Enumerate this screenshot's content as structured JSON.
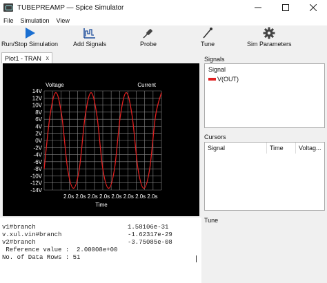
{
  "window": {
    "title": "TUBEPREAMP — Spice Simulator",
    "minimize_icon": "minimize-icon",
    "maximize_icon": "maximize-icon",
    "close_icon": "close-icon"
  },
  "menu": [
    "File",
    "Simulation",
    "View"
  ],
  "toolbar": [
    {
      "label": "Run/Stop Simulation",
      "icon": "play-icon"
    },
    {
      "label": "Add Signals",
      "icon": "signal-icon"
    },
    {
      "label": "Probe",
      "icon": "probe-icon"
    },
    {
      "label": "Tune",
      "icon": "tune-icon"
    },
    {
      "label": "Sim Parameters",
      "icon": "gear-icon"
    }
  ],
  "tab": {
    "label": "Plot1 - TRAN",
    "close": "x"
  },
  "plot": {
    "left_axis_label": "Voltage",
    "right_axis_label": "Current",
    "xlabel": "Time",
    "background": "#000000",
    "grid_color": "#8a8a8a",
    "trace_color": "#e02020",
    "y_ticks": [
      "14V",
      "12V",
      "10V",
      "8V",
      "6V",
      "4V",
      "2V",
      "0V",
      "-2V",
      "-4V",
      "-6V",
      "-8V",
      "-10V",
      "-12V",
      "-14V"
    ],
    "x_ticks": "2.0s 2.0s 2.0s 2.0s 2.0s 2.0s 2.0s 2.0s",
    "trace_name": "V(OUT)"
  },
  "chart_data": {
    "type": "line",
    "title": "",
    "xlabel": "Time",
    "ylabel": "Voltage",
    "ylim": [
      -14,
      14
    ],
    "grid": true,
    "series": [
      {
        "name": "V(OUT)",
        "color": "#e02020",
        "x": [
          0,
          0.5,
          1,
          1.5,
          2,
          2.5,
          3,
          3.5,
          4,
          4.5,
          5,
          5.5,
          6,
          6.5,
          7,
          7.5,
          8,
          8.5,
          9,
          9.5,
          10
        ],
        "values": [
          -8,
          7,
          13.5,
          7,
          -8,
          -13.5,
          -8,
          7,
          13.5,
          7,
          -8,
          -13.5,
          -8,
          7,
          13.5,
          7,
          -8,
          -13.5,
          -8,
          7,
          13.5
        ]
      }
    ]
  },
  "console": [
    {
      "name": "v1#branch",
      "value": "1.58106e-31"
    },
    {
      "name": "v.xul.vin#branch",
      "value": "-1.62317e-29"
    },
    {
      "name": "v2#branch",
      "value": "-3.75085e-08"
    },
    {
      "name": " Reference value :  2.00008e+00",
      "value": ""
    },
    {
      "name": "No. of Data Rows : 51",
      "value": ""
    }
  ],
  "signals": {
    "header": "Signals",
    "column": "Signal",
    "items": [
      {
        "name": "V(OUT)",
        "color": "#e02020"
      }
    ]
  },
  "cursors": {
    "header": "Cursors",
    "columns": [
      "Signal",
      "Time",
      "Voltag..."
    ]
  },
  "tune": {
    "header": "Tune"
  }
}
